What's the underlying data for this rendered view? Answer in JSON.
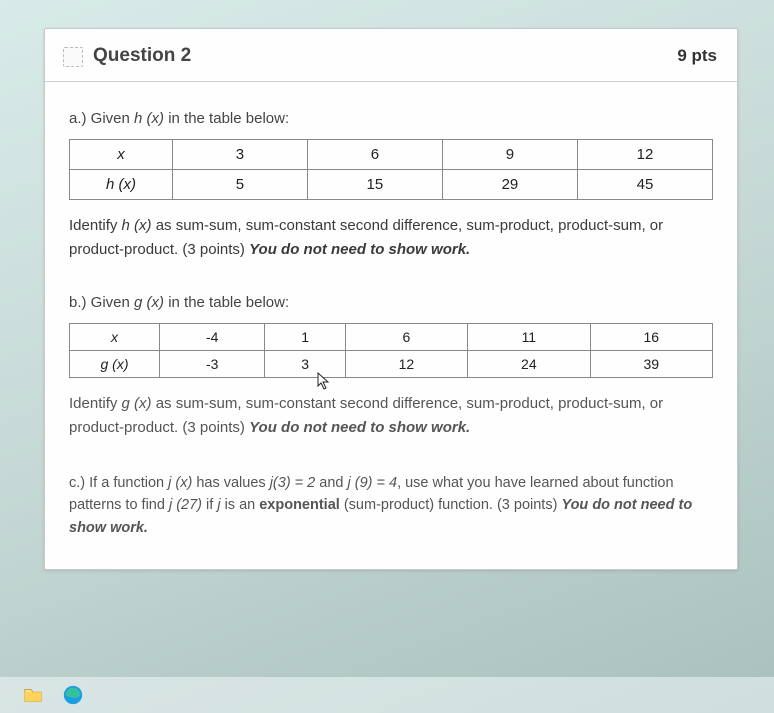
{
  "header": {
    "title": "Question 2",
    "points": "9 pts"
  },
  "partA": {
    "label_pre": "a.) Given ",
    "label_fx": "h (x)",
    "label_post": " in the table below:",
    "row1_label": "x",
    "row2_label": "h (x)",
    "cols": [
      "3",
      "6",
      "9",
      "12"
    ],
    "vals": [
      "5",
      "15",
      "29",
      "45"
    ],
    "instruction_pre": "Identify ",
    "instruction_fx": "h (x)",
    "instruction_mid": " as sum-sum, sum-constant second difference, sum-product, product-sum, or product-product. (3 points) ",
    "instruction_bold": "You do not need to show work."
  },
  "partB": {
    "label_pre": "b.) Given ",
    "label_fx": "g (x)",
    "label_post": " in the table below:",
    "row1_label": "x",
    "row2_label": "g (x)",
    "cols": [
      "-4",
      "1",
      "6",
      "11",
      "16"
    ],
    "vals": [
      "-3",
      "3",
      "12",
      "24",
      "39"
    ],
    "instruction_pre": "Identify ",
    "instruction_fx": "g (x)",
    "instruction_mid": " as sum-sum, sum-constant second difference, sum-product, product-sum, or product-product. (3 points) ",
    "instruction_bold": "You do not need to show work."
  },
  "partC": {
    "text1": "c.) If a function ",
    "fx1": "j (x)",
    "text2": " has values ",
    "fx2": "j(3) = 2",
    "text3": " and ",
    "fx3": "j (9) = 4",
    "text4": ", use what you have learned about function patterns to find ",
    "fx4": "j (27)",
    "text5": " if ",
    "fx5": "j",
    "text6": " is an ",
    "bold1": "exponential",
    "text7": " (sum-product) function. (3 points) ",
    "bold2": "You do not need to show work."
  },
  "chart_data": [
    {
      "type": "table",
      "title": "h(x)",
      "x": [
        3,
        6,
        9,
        12
      ],
      "y": [
        5,
        15,
        29,
        45
      ]
    },
    {
      "type": "table",
      "title": "g(x)",
      "x": [
        -4,
        1,
        6,
        11,
        16
      ],
      "y": [
        -3,
        3,
        12,
        24,
        39
      ]
    }
  ]
}
